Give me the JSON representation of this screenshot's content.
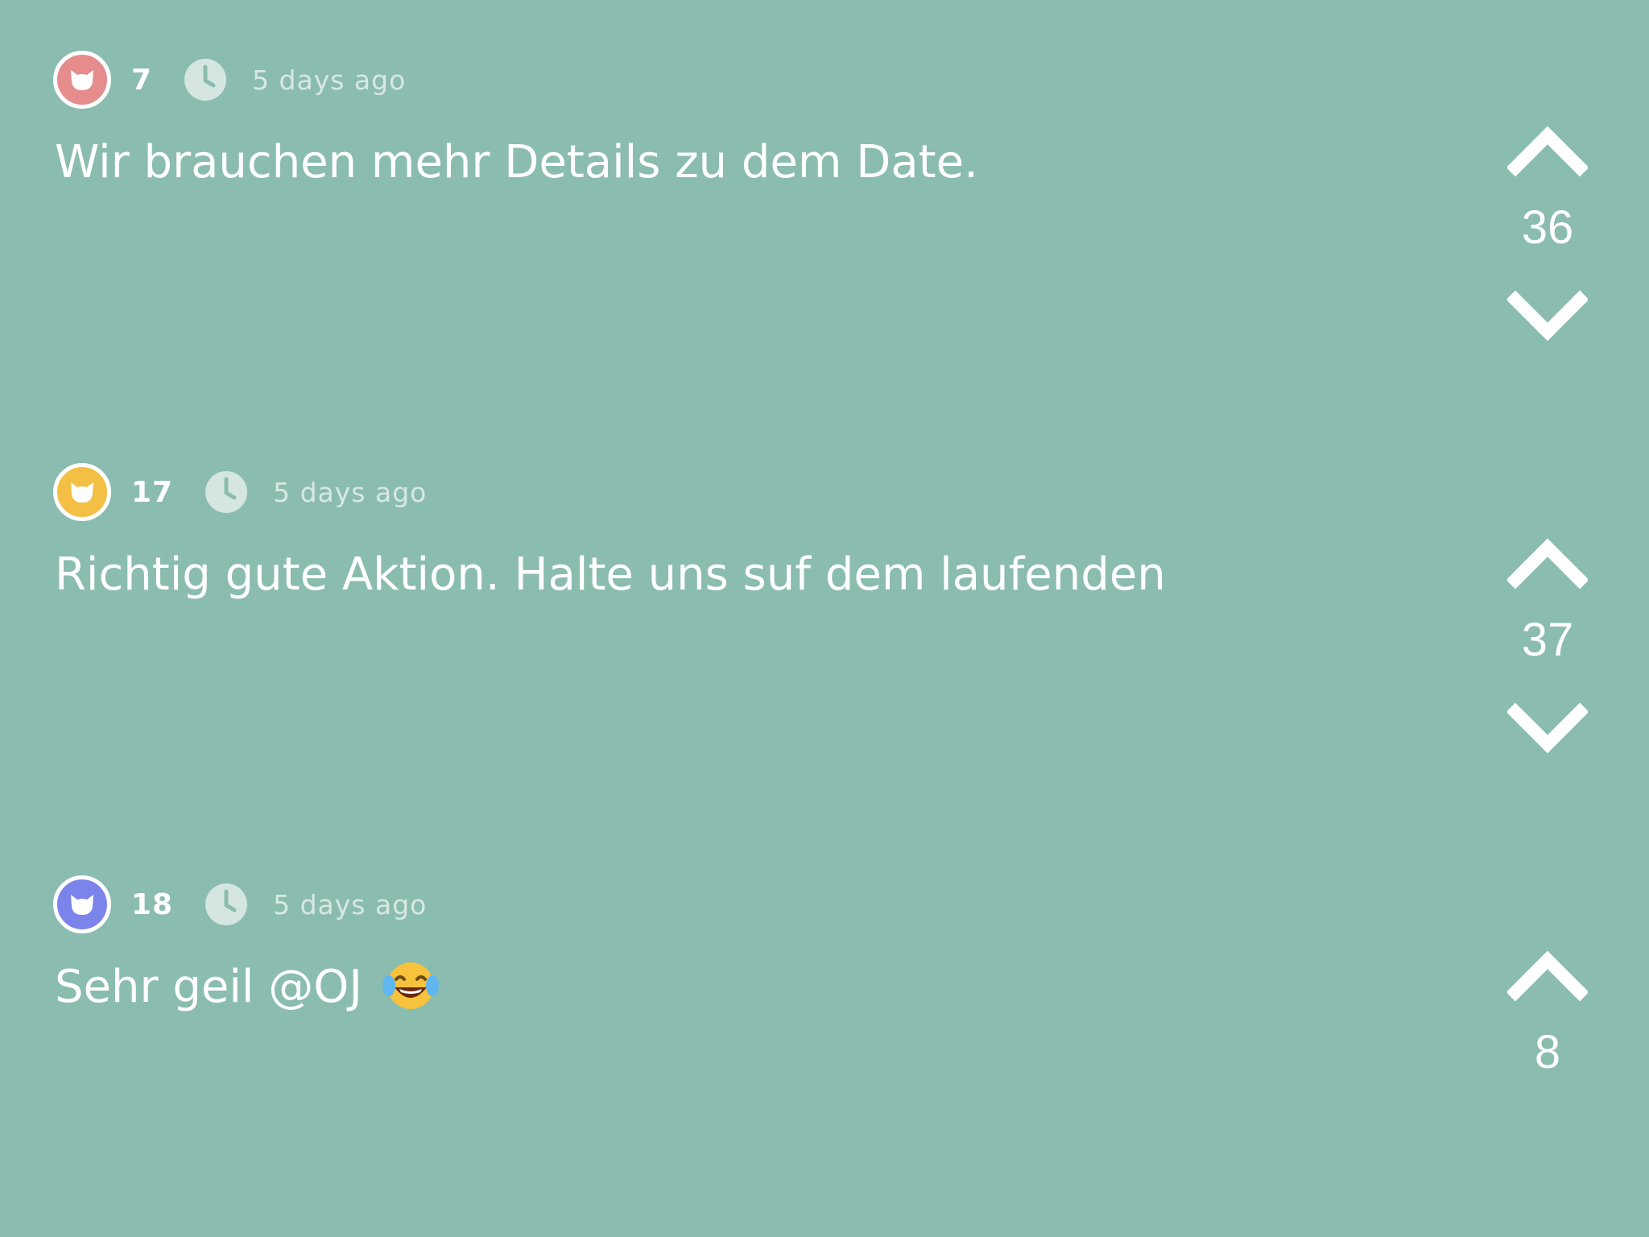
{
  "comments": [
    {
      "avatar_color": "#e68c8c",
      "avatar_icon": "cat-face-icon",
      "poster_number": "7",
      "timestamp": "5 days ago",
      "text": "Wir brauchen mehr Details zu dem Date.",
      "votes": "36"
    },
    {
      "avatar_color": "#f4bf45",
      "avatar_icon": "cat-face-icon",
      "poster_number": "17",
      "timestamp": "5 days ago",
      "text": "Richtig gute Aktion. Halte uns suf dem laufenden",
      "votes": "37"
    },
    {
      "avatar_color": "#7b84ea",
      "avatar_icon": "cat-face-icon",
      "poster_number": "18",
      "timestamp": "5 days ago",
      "text": "Sehr geil @OJ",
      "emoji": "face-with-tears-of-joy-icon",
      "votes": "8"
    }
  ]
}
